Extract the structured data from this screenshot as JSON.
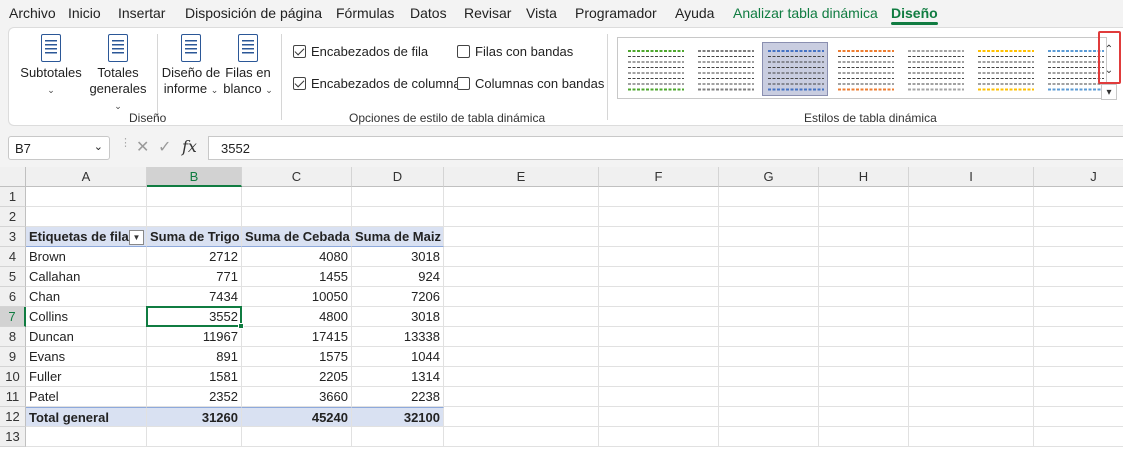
{
  "menu": {
    "items": [
      "Archivo",
      "Inicio",
      "Insertar",
      "Disposición de página",
      "Fórmulas",
      "Datos",
      "Revisar",
      "Vista",
      "Programador",
      "Ayuda"
    ],
    "context_tab": "Analizar tabla dinámica",
    "active_tab": "Diseño"
  },
  "ribbon": {
    "layout_group": {
      "label": "Diseño",
      "subtotals": "Subtotales",
      "grand_totals": [
        "Totales",
        "generales"
      ],
      "report_layout": [
        "Diseño de",
        "informe"
      ],
      "blank_rows": [
        "Filas en",
        "blanco"
      ]
    },
    "style_options_group": {
      "label": "Opciones de estilo de tabla dinámica",
      "row_headers": {
        "label": "Encabezados de fila",
        "checked": true
      },
      "column_headers": {
        "label": "Encabezados de columna",
        "checked": true
      },
      "banded_rows": {
        "label": "Filas con bandas",
        "checked": false
      },
      "banded_columns": {
        "label": "Columnas con bandas",
        "checked": false
      }
    },
    "styles_group": {
      "label": "Estilos de tabla dinámica",
      "thumb_colors": [
        "#4ea72e",
        "#7f7f7f",
        "#4472c4",
        "#ed7d31",
        "#a5a5a5",
        "#ffc000",
        "#5b9bd5"
      ],
      "selected_index": 2
    }
  },
  "formula_bar": {
    "name_box": "B7",
    "fx": "fx",
    "value": "3552"
  },
  "grid": {
    "columns": [
      "A",
      "B",
      "C",
      "D",
      "E",
      "F",
      "G",
      "H",
      "I",
      "J"
    ],
    "rows": [
      "1",
      "2",
      "3",
      "4",
      "5",
      "6",
      "7",
      "8",
      "9",
      "10",
      "11",
      "12",
      "13"
    ],
    "selected_column": "B",
    "selected_row": "7"
  },
  "pivot": {
    "headers": [
      "Etiquetas de fila",
      "Suma de Trigo",
      "Suma de Cebada",
      "Suma de Maiz"
    ],
    "rows": [
      [
        "Brown",
        "2712",
        "4080",
        "3018"
      ],
      [
        "Callahan",
        "771",
        "1455",
        "924"
      ],
      [
        "Chan",
        "7434",
        "10050",
        "7206"
      ],
      [
        "Collins",
        "3552",
        "4800",
        "3018"
      ],
      [
        "Duncan",
        "11967",
        "17415",
        "13338"
      ],
      [
        "Evans",
        "891",
        "1575",
        "1044"
      ],
      [
        "Fuller",
        "1581",
        "2205",
        "1314"
      ],
      [
        "Patel",
        "2352",
        "3660",
        "2238"
      ]
    ],
    "total": [
      "Total general",
      "31260",
      "45240",
      "32100"
    ]
  },
  "colors": {
    "accent": "#107c41",
    "highlight_frame": "#e03b3b",
    "pivot_header_bg": "#d9e1f2"
  }
}
